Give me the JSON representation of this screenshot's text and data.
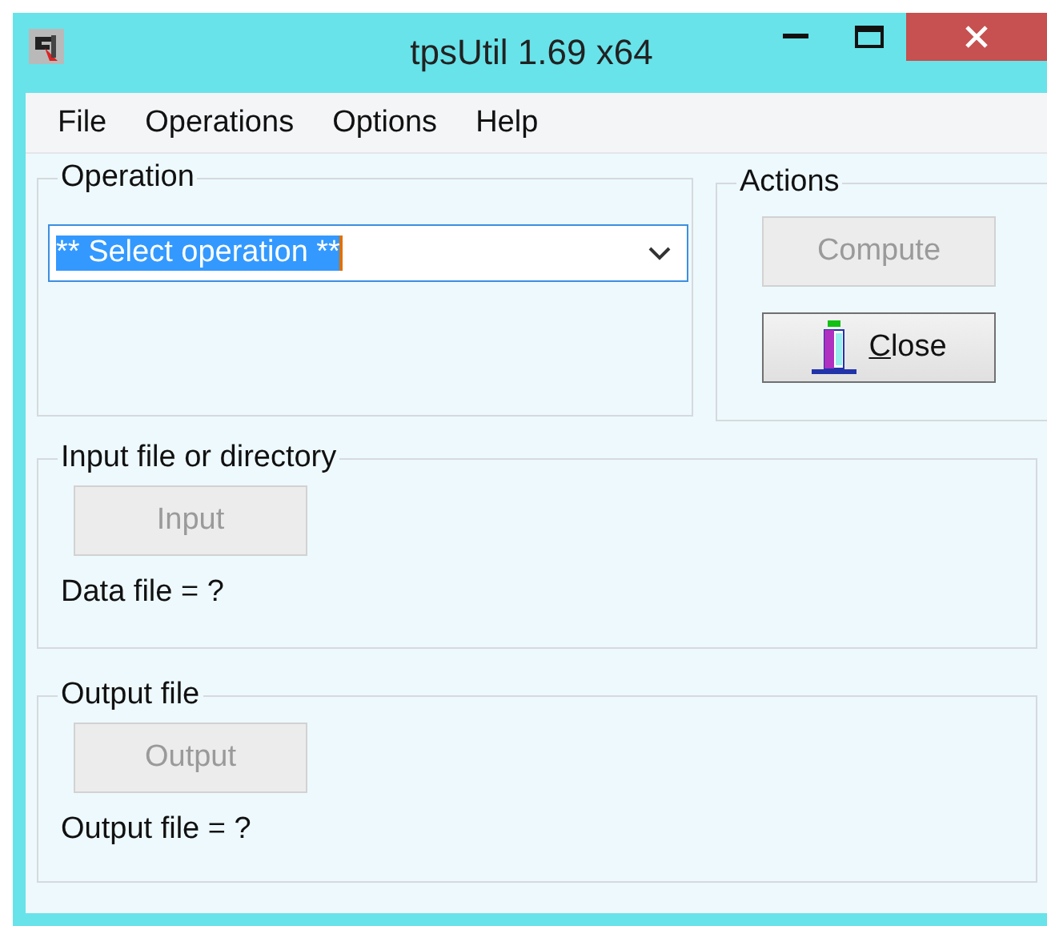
{
  "window": {
    "title": "tpsUtil 1.69 x64"
  },
  "menu": [
    "File",
    "Operations",
    "Options",
    "Help"
  ],
  "operation": {
    "label": "Operation",
    "value": "** Select operation **",
    "selected_text": true
  },
  "actions": {
    "label": "Actions",
    "buttons": [
      {
        "label": "Compute",
        "disabled": true,
        "icon": false,
        "first_letter_underlined": false
      },
      {
        "label": "Close",
        "disabled": false,
        "icon": true,
        "first_letter_underlined": true
      }
    ]
  },
  "input": {
    "label": "Input file or directory",
    "button": {
      "label": "Input",
      "disabled": true
    },
    "status": "Data file = ?"
  },
  "output": {
    "label": "Output file",
    "button": {
      "label": "Output",
      "disabled": true
    },
    "status": "Output file = ?"
  }
}
